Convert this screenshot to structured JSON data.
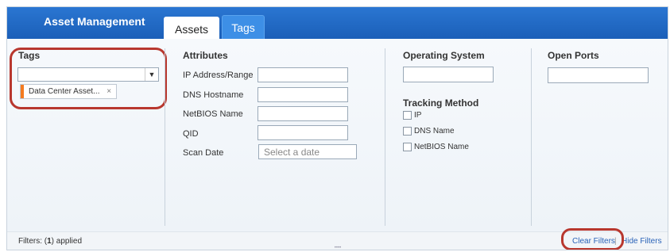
{
  "app": {
    "title": "Asset Management"
  },
  "tabs": [
    {
      "label": "Assets",
      "active": true
    },
    {
      "label": "Tags",
      "active": false
    }
  ],
  "tags_panel": {
    "heading": "Tags",
    "select_value": "",
    "chip_label": "Data Center Asset...",
    "chip_remove": "×"
  },
  "attributes": {
    "heading": "Attributes",
    "fields": [
      {
        "label": "IP Address/Range",
        "value": ""
      },
      {
        "label": "DNS Hostname",
        "value": ""
      },
      {
        "label": "NetBIOS Name",
        "value": ""
      },
      {
        "label": "QID",
        "value": ""
      }
    ],
    "scan_date": {
      "label": "Scan Date",
      "placeholder": "Select a date"
    }
  },
  "operating_system": {
    "heading": "Operating System",
    "value": ""
  },
  "tracking_method": {
    "heading": "Tracking Method",
    "options": [
      {
        "label": "IP",
        "checked": false
      },
      {
        "label": "DNS Name",
        "checked": false
      },
      {
        "label": "NetBIOS Name",
        "checked": false
      }
    ]
  },
  "open_ports": {
    "heading": "Open Ports",
    "value": ""
  },
  "footer": {
    "filters_prefix": "Filters: (",
    "filters_count": "1",
    "filters_suffix": ") applied",
    "clear_filters": "Clear Filters",
    "separator": "|",
    "hide_filters": "Hide Filters"
  },
  "colors": {
    "header_blue": "#1b5fb8",
    "highlight_red": "#b8372e",
    "tag_orange": "#f47b20",
    "link_blue": "#2a63b8"
  }
}
